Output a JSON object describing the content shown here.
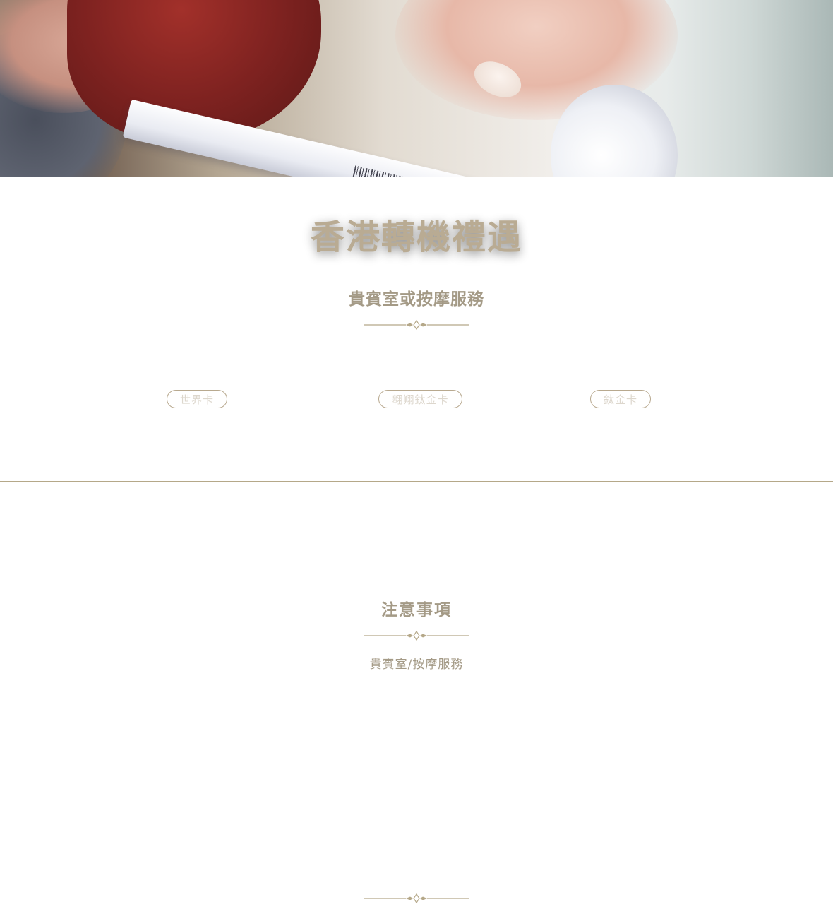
{
  "hero": {
    "image_alt": "hand holding boarding pass"
  },
  "title": "香港轉機禮遇",
  "subtitle": "貴賓室或按摩服務",
  "tabs": [
    {
      "label": "世界卡"
    },
    {
      "label": "翱翔鈦金卡"
    },
    {
      "label": "鈦金卡"
    }
  ],
  "notes": {
    "title": "注意事項",
    "subtitle": "貴賓室/按摩服務"
  },
  "colors": {
    "gold": "#b8a98f",
    "text": "#a49a86",
    "tab_text": "#ddd7cd"
  }
}
